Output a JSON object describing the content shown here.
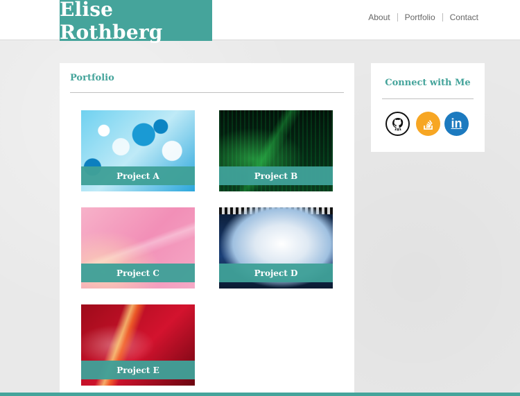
{
  "header": {
    "brand": "Elise Rothberg",
    "nav": [
      {
        "label": "About"
      },
      {
        "label": "Portfolio"
      },
      {
        "label": "Contact"
      }
    ]
  },
  "portfolio": {
    "title": "Portfolio",
    "projects": [
      {
        "label": "Project A"
      },
      {
        "label": "Project B"
      },
      {
        "label": "Project C"
      },
      {
        "label": "Project D"
      },
      {
        "label": "Project E"
      }
    ]
  },
  "sidebar": {
    "title": "Connect with Me",
    "links": [
      {
        "icon": "github-icon"
      },
      {
        "icon": "stackoverflow-icon"
      },
      {
        "icon": "linkedin-icon",
        "glyph": "in"
      }
    ]
  },
  "colors": {
    "accent": "#45a49b",
    "background": "#e9e9e9",
    "github": "#111111",
    "stackoverflow": "#f7a623",
    "linkedin": "#1c7abf"
  }
}
